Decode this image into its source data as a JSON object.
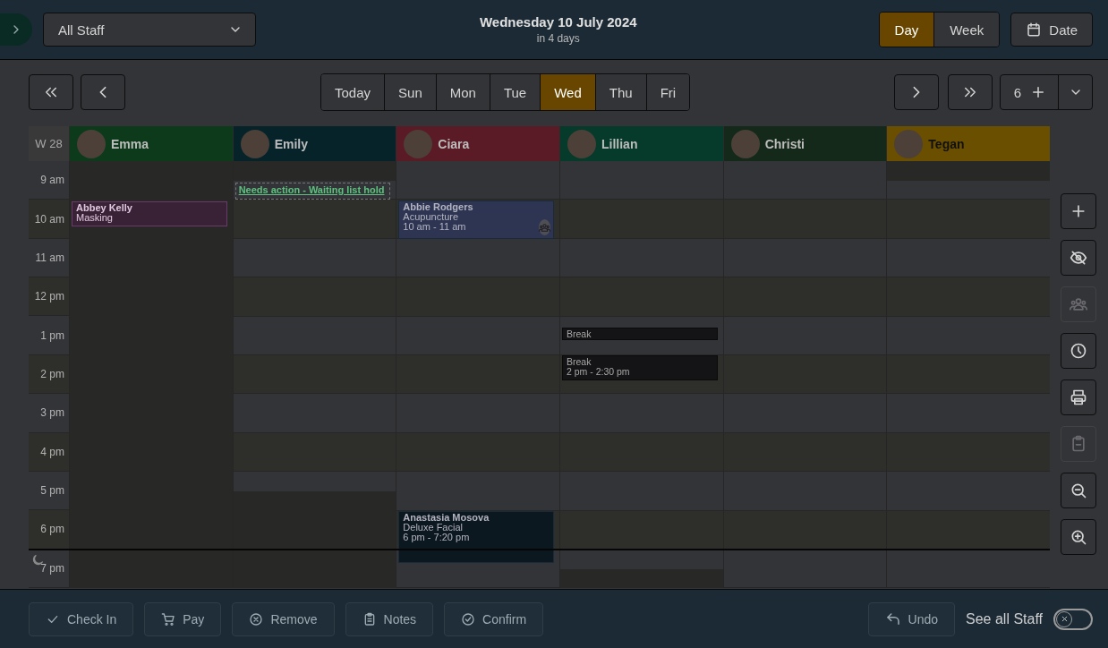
{
  "header": {
    "staff_select": {
      "value": "All Staff"
    },
    "date_title": "Wednesday 10 July 2024",
    "date_subtitle": "in 4 days",
    "view_toggle": [
      {
        "label": "Day",
        "selected": true
      },
      {
        "label": "Week",
        "selected": false
      }
    ],
    "date_button": {
      "label": "Date"
    }
  },
  "nav": {
    "day_tabs": [
      {
        "label": "Today",
        "selected": false
      },
      {
        "label": "Sun",
        "selected": false
      },
      {
        "label": "Mon",
        "selected": false
      },
      {
        "label": "Tue",
        "selected": false
      },
      {
        "label": "Wed",
        "selected": true
      },
      {
        "label": "Thu",
        "selected": false
      },
      {
        "label": "Fri",
        "selected": false
      }
    ],
    "staff_count": "6"
  },
  "calendar": {
    "week_label": "W 28",
    "hours": [
      "9 am",
      "10 am",
      "11 am",
      "12 pm",
      "1 pm",
      "2 pm",
      "3 pm",
      "4 pm",
      "5 pm",
      "6 pm",
      "7 pm"
    ],
    "staff": [
      {
        "name": "Emma",
        "color": "#0c3a1a",
        "events": [
          {
            "kind": "appointment",
            "color": "#3a2236",
            "title": "Abbey Kelly",
            "service": "Masking"
          }
        ]
      },
      {
        "name": "Emily",
        "color": "#06232a",
        "events": [
          {
            "kind": "hold",
            "title": "Needs action - Waiting list hold"
          }
        ]
      },
      {
        "name": "Ciara",
        "color": "#5a1a26",
        "events": [
          {
            "kind": "appointment",
            "color": "#2d3553",
            "title": "Abbie Rodgers",
            "service": "Acupuncture",
            "time": "10 am - 11 am",
            "group": true
          },
          {
            "kind": "appointment",
            "color": "#0c1820",
            "title": "Anastasia Mosova",
            "service": "Deluxe Facial",
            "time": "6 pm - 7:20 pm",
            "group": false
          }
        ]
      },
      {
        "name": "Lillian",
        "color": "#063a2a",
        "events": [
          {
            "kind": "break",
            "title": "Break"
          },
          {
            "kind": "break",
            "title": "Break",
            "time": "2 pm - 2:30 pm"
          }
        ]
      },
      {
        "name": "Christi",
        "color": "#15291a"
      },
      {
        "name": "Tegan",
        "color": "#6b4f00"
      }
    ]
  },
  "side_tools": [
    {
      "disabled": false
    },
    {
      "disabled": false
    },
    {
      "disabled": true
    },
    {
      "disabled": false
    },
    {
      "disabled": false
    },
    {
      "disabled": true
    },
    {
      "disabled": false
    },
    {
      "disabled": false
    }
  ],
  "footer": {
    "actions": [
      {
        "label": "Check In"
      },
      {
        "label": "Pay"
      },
      {
        "label": "Remove"
      },
      {
        "label": "Notes"
      },
      {
        "label": "Confirm"
      }
    ],
    "undo": {
      "label": "Undo"
    },
    "see_all_staff": {
      "label": "See all Staff",
      "on": false
    }
  }
}
